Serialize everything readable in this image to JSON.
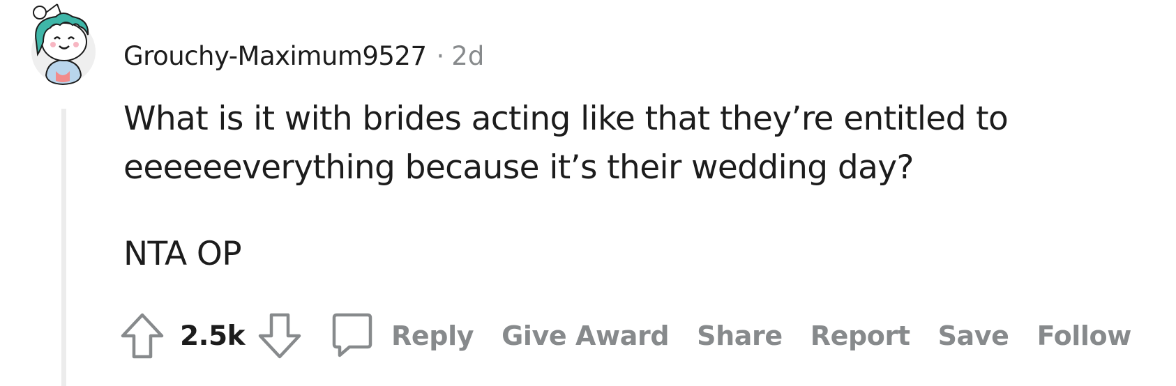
{
  "comment": {
    "username": "Grouchy-Maximum9527",
    "separator": "·",
    "timestamp": "2d",
    "body": [
      "What is it with brides acting like that they’re entitled to eeeeeeverything because it’s their wedding day?",
      "NTA OP"
    ],
    "score": "2.5k",
    "actions": {
      "reply": "Reply",
      "give_award": "Give Award",
      "share": "Share",
      "report": "Report",
      "save": "Save",
      "follow": "Follow"
    },
    "icons": {
      "avatar": "snoo-avatar-icon",
      "upvote": "arrow-up-icon",
      "downvote": "arrow-down-icon",
      "reply": "comment-bubble-icon"
    },
    "colors": {
      "text": "#1c1c1c",
      "muted": "#878a8c",
      "thread_line": "#ececec",
      "avatar_hair": "#3fb6a8"
    }
  }
}
